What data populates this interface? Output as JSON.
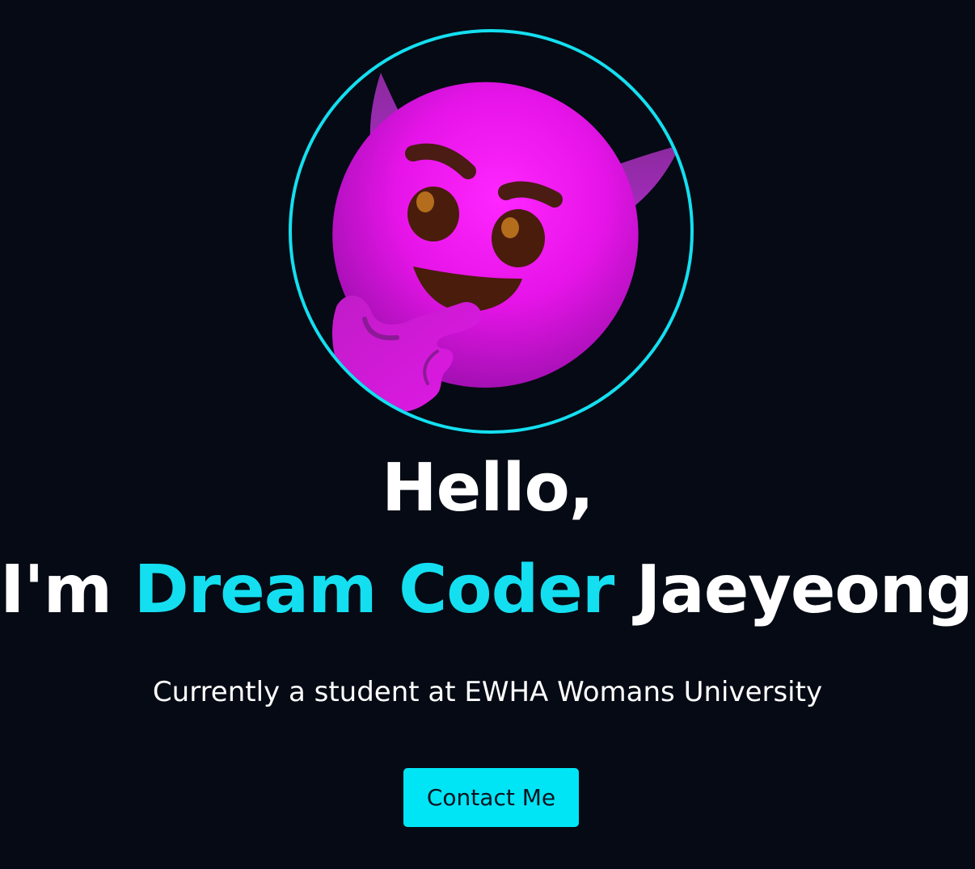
{
  "hero": {
    "avatar": {
      "icon": "smiling-devil-thinking-emoji",
      "ring_color": "#14dff0"
    },
    "greeting": "Hello,",
    "intro_prefix": "I'm",
    "intro_highlight": "Dream Coder",
    "intro_suffix": "Jaeyeong!",
    "subtitle": "Currently a student at EWHA Womans University",
    "contact_button_label": "Contact Me"
  },
  "colors": {
    "background": "#050a14",
    "accent": "#14dff0",
    "button": "#00e5f5",
    "text": "#ffffff"
  }
}
